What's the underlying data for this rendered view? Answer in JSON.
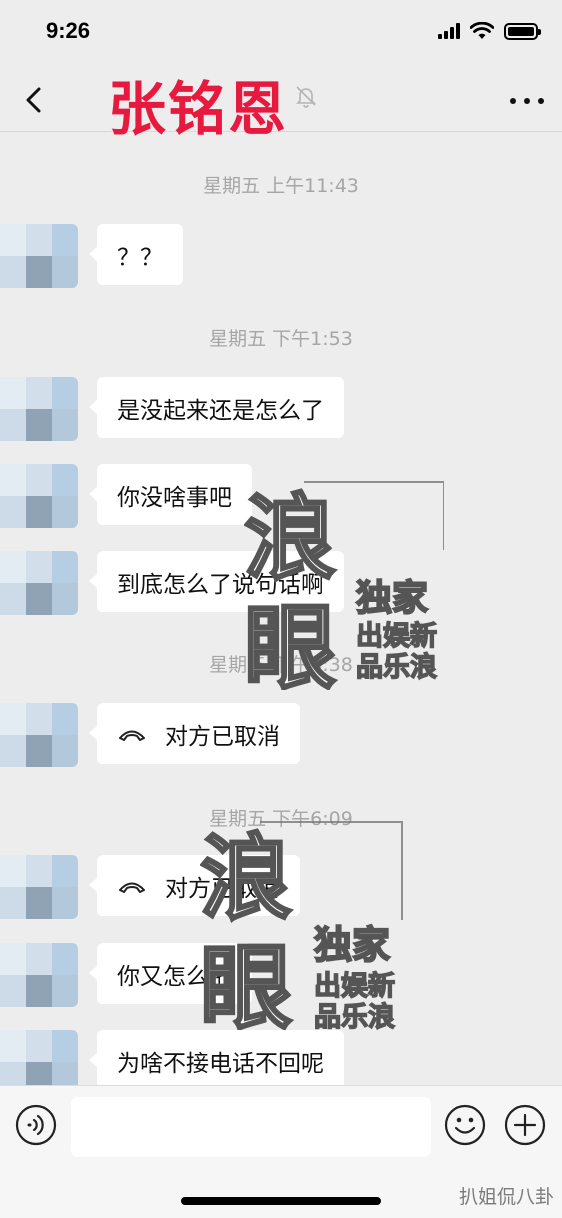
{
  "status_bar": {
    "time": "9:26"
  },
  "header": {
    "title": "张铭恩"
  },
  "chat": {
    "timestamps": [
      "星期五 上午11:43",
      "星期五 下午1:53",
      "星期五 下午4:38",
      "星期五 下午6:09"
    ],
    "messages": [
      {
        "text": "？？",
        "type": "text"
      },
      {
        "text": "是没起来还是怎么了",
        "type": "text"
      },
      {
        "text": "你没啥事吧",
        "type": "text"
      },
      {
        "text": "到底怎么了说句话啊",
        "type": "text"
      },
      {
        "text": "对方已取消",
        "type": "call",
        "icon": "phone-hangup-icon"
      },
      {
        "text": "对方已取消",
        "type": "call",
        "icon": "phone-hangup-icon"
      },
      {
        "text": "你又怎么啦",
        "type": "text"
      },
      {
        "text": "为啥不接电话不回呢",
        "type": "text"
      }
    ]
  },
  "watermark": {
    "big_top": "浪",
    "big_bottom": "眼",
    "line1": "独家",
    "line2": "出娱新",
    "line3": "品乐浪"
  },
  "input_bar": {
    "value": "",
    "placeholder": ""
  },
  "corner_mark": "扒姐侃八卦",
  "colors": {
    "title": "#e8193f",
    "background": "#ededed",
    "bubble": "#ffffff"
  }
}
